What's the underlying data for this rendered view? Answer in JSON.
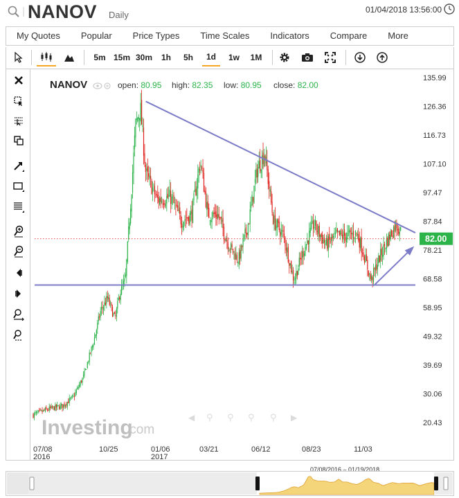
{
  "header": {
    "ticker": "NANOV",
    "timeframe": "Daily",
    "datetime": "01/04/2018 13:56:00"
  },
  "menu": [
    "My Quotes",
    "Popular",
    "Price Types",
    "Time Scales",
    "Indicators",
    "Compare",
    "More"
  ],
  "toolbar": {
    "intervals": [
      "5m",
      "15m",
      "30m",
      "1h",
      "5h",
      "1d",
      "1w",
      "1M"
    ],
    "active_interval": "1d"
  },
  "legend": {
    "ticker": "NANOV",
    "open_label": "open:",
    "open": "80.95",
    "high_label": "high:",
    "high": "82.35",
    "low_label": "low:",
    "low": "80.95",
    "close_label": "close:",
    "close": "82.00"
  },
  "watermark": {
    "brand": "Investing",
    "suffix": ".com"
  },
  "navigator": {
    "range_label": "07/08/2016 – 01/19/2018"
  },
  "colors": {
    "up": "#2cb34a",
    "down": "#e0201b",
    "trendline": "#7b7bc8",
    "last_price_bg": "#2cb34a",
    "accent": "#f5a623"
  },
  "chart_data": {
    "type": "candlestick",
    "title": "NANOV",
    "yaxis": {
      "ticks": [
        135.99,
        126.36,
        116.73,
        107.1,
        97.47,
        87.84,
        78.21,
        68.58,
        58.95,
        49.32,
        39.69,
        30.06,
        20.43
      ],
      "position": "right"
    },
    "xaxis": {
      "ticks": [
        "07/08\n2016",
        "10/25",
        "01/06\n2017",
        "03/21",
        "06/12",
        "08/23",
        "11/03"
      ]
    },
    "last_price": "82.00",
    "grid": false,
    "series": [
      {
        "name": "NANOV",
        "kind": "close_approx",
        "x": [
          "2016-07-08",
          "2016-08-01",
          "2016-08-20",
          "2016-09-05",
          "2016-09-20",
          "2016-10-05",
          "2016-10-15",
          "2016-10-25",
          "2016-11-05",
          "2016-11-12",
          "2016-11-20",
          "2016-11-28",
          "2016-12-05",
          "2016-12-12",
          "2016-12-20",
          "2017-01-06",
          "2017-01-25",
          "2017-02-10",
          "2017-02-25",
          "2017-03-10",
          "2017-03-21",
          "2017-04-05",
          "2017-04-20",
          "2017-05-05",
          "2017-05-20",
          "2017-06-01",
          "2017-06-12",
          "2017-06-25",
          "2017-07-10",
          "2017-07-25",
          "2017-08-05",
          "2017-08-23",
          "2017-09-10",
          "2017-09-25",
          "2017-10-10",
          "2017-10-25",
          "2017-11-03",
          "2017-11-15",
          "2017-11-28",
          "2017-12-10",
          "2017-12-22",
          "2018-01-04"
        ],
        "y": [
          23,
          25,
          26,
          29,
          36,
          48,
          58,
          62,
          55,
          64,
          68,
          95,
          120,
          126,
          104,
          95,
          96,
          88,
          90,
          108,
          90,
          90,
          80,
          75,
          88,
          105,
          111,
          88,
          83,
          68,
          76,
          87,
          80,
          83,
          83,
          84,
          78,
          68,
          76,
          82,
          87,
          82
        ]
      }
    ],
    "annotations": [
      {
        "type": "trendline",
        "from": [
          "2016-12-20",
          128
        ],
        "to": [
          "2018-01-19",
          84
        ]
      },
      {
        "type": "horizontal",
        "y": 66.5
      },
      {
        "type": "arrow",
        "from": [
          "2017-11-20",
          66.5
        ],
        "to": [
          "2018-01-15",
          79
        ]
      }
    ]
  }
}
